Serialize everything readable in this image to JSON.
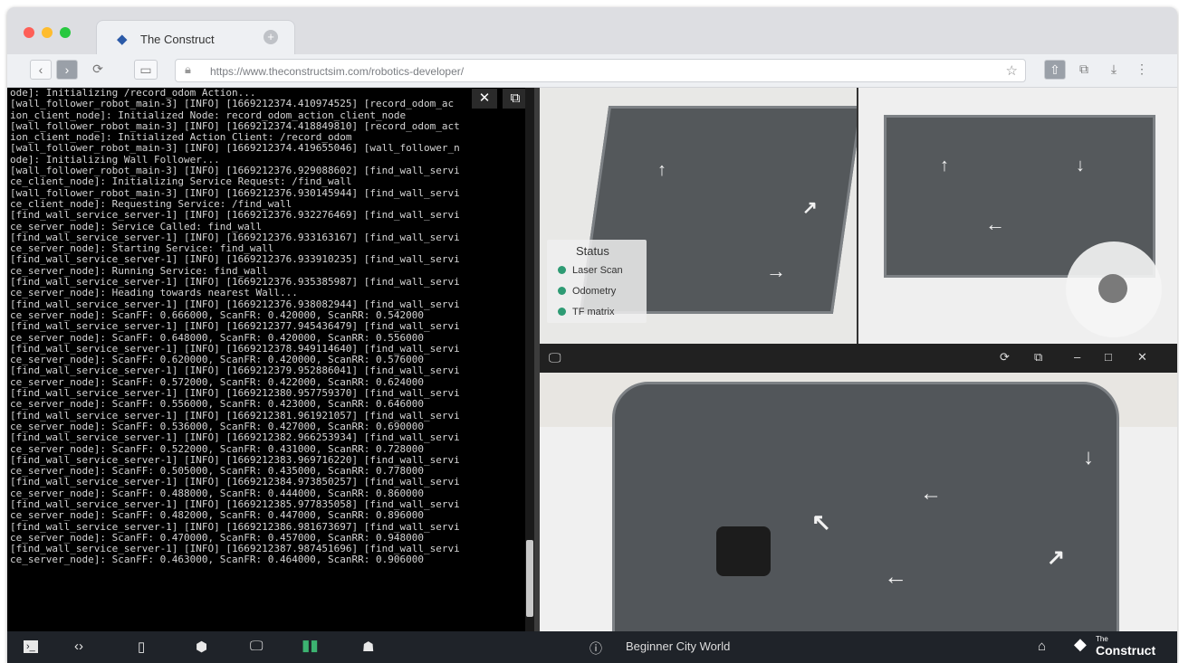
{
  "browser": {
    "tab_title": "The Construct",
    "url": "https://www.theconstructsim.com/robotics-developer/"
  },
  "terminal": {
    "lines": [
      "ode]: Initializing /record_odom Action...",
      "[wall_follower_robot_main-3] [INFO] [1669212374.410974525] [record_odom_ac",
      "ion_client_node]: Initialized Node: record_odom_action_client_node",
      "[wall_follower_robot_main-3] [INFO] [1669212374.418849810] [record_odom_act",
      "ion_client_node]: Initialized Action Client: /record_odom",
      "[wall_follower_robot_main-3] [INFO] [1669212374.419655046] [wall_follower_n",
      "ode]: Initializing Wall Follower...",
      "[wall_follower_robot_main-3] [INFO] [1669212376.929088602] [find_wall_servi",
      "ce_client_node]: Initializing Service Request: /find_wall",
      "[wall_follower_robot_main-3] [INFO] [1669212376.930145944] [find_wall_servi",
      "ce_client_node]: Requesting Service: /find_wall",
      "[find_wall_service_server-1] [INFO] [1669212376.932276469] [find_wall_servi",
      "ce_server_node]: Service Called: find_wall",
      "[find_wall_service_server-1] [INFO] [1669212376.933163167] [find_wall_servi",
      "ce_server_node]: Starting Service: find_wall",
      "[find_wall_service_server-1] [INFO] [1669212376.933910235] [find_wall_servi",
      "ce_server_node]: Running Service: find_wall",
      "[find_wall_service_server-1] [INFO] [1669212376.935385987] [find_wall_servi",
      "ce_server_node]: Heading towards nearest Wall...",
      "[find_wall_service_server-1] [INFO] [1669212376.938082944] [find_wall_servi",
      "ce_server_node]: ScanFF: 0.666000, ScanFR: 0.420000, ScanRR: 0.542000",
      "[find_wall_service_server-1] [INFO] [1669212377.945436479] [find_wall_servi",
      "ce_server_node]: ScanFF: 0.648000, ScanFR: 0.420000, ScanRR: 0.556000",
      "[find_wall_service_server-1] [INFO] [1669212378.949114640] [find_wall_servi",
      "ce_server_node]: ScanFF: 0.620000, ScanFR: 0.420000, ScanRR: 0.576000",
      "[find_wall_service_server-1] [INFO] [1669212379.952886041] [find_wall_servi",
      "ce_server_node]: ScanFF: 0.572000, ScanFR: 0.422000, ScanRR: 0.624000",
      "[find_wall_service_server-1] [INFO] [1669212380.957759370] [find_wall_servi",
      "ce_server_node]: ScanFF: 0.556000, ScanFR: 0.423000, ScanRR: 0.646000",
      "[find_wall_service_server-1] [INFO] [1669212381.961921057] [find_wall_servi",
      "ce_server_node]: ScanFF: 0.536000, ScanFR: 0.427000, ScanRR: 0.690000",
      "[find_wall_service_server-1] [INFO] [1669212382.966253934] [find_wall_servi",
      "ce_server_node]: ScanFF: 0.522000, ScanFR: 0.431000, ScanRR: 0.728000",
      "[find_wall_service_server-1] [INFO] [1669212383.969716220] [find_wall_servi",
      "ce_server_node]: ScanFF: 0.505000, ScanFR: 0.435000, ScanRR: 0.778000",
      "[find_wall_service_server-1] [INFO] [1669212384.973850257] [find_wall_servi",
      "ce_server_node]: ScanFF: 0.488000, ScanFR: 0.444000, ScanRR: 0.860000",
      "[find_wall_service_server-1] [INFO] [1669212385.977835058] [find_wall_servi",
      "ce_server_node]: ScanFF: 0.482000, ScanFR: 0.447000, ScanRR: 0.896000",
      "[find_wall_service_server-1] [INFO] [1669212386.981673697] [find_wall_servi",
      "ce_server_node]: ScanFF: 0.470000, ScanFR: 0.457000, ScanRR: 0.948000",
      "[find_wall_service_server-1] [INFO] [1669212387.987451696] [find_wall_servi",
      "ce_server_node]: ScanFF: 0.463000, ScanFR: 0.464000, ScanRR: 0.906000"
    ]
  },
  "status_panel": {
    "title": "Status",
    "items": [
      "Laser Scan",
      "Odometry",
      "TF matrix"
    ],
    "indicator_color": "#2e9b74"
  },
  "taskbar": {
    "world_name": "Beginner City World",
    "brand_small": "The",
    "brand": "Construct",
    "active_color": "#3cb371"
  },
  "icons": {
    "terminal": "terminal-icon",
    "code": "code-icon",
    "notebook": "notebook-icon",
    "package": "cube-icon",
    "desktop": "desktop-icon",
    "book": "book-icon",
    "robot": "robot-icon",
    "info": "info-icon",
    "home": "home-icon"
  }
}
